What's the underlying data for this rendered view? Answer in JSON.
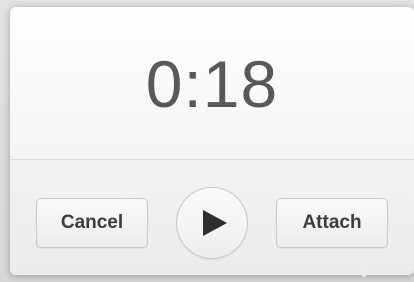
{
  "recorder": {
    "elapsed_time": "0:18",
    "cancel_label": "Cancel",
    "attach_label": "Attach",
    "play_icon": "play-icon"
  },
  "colors": {
    "text": "#585858",
    "button_text": "#3c3c3c",
    "panel_bg": "#f7f7f7"
  }
}
